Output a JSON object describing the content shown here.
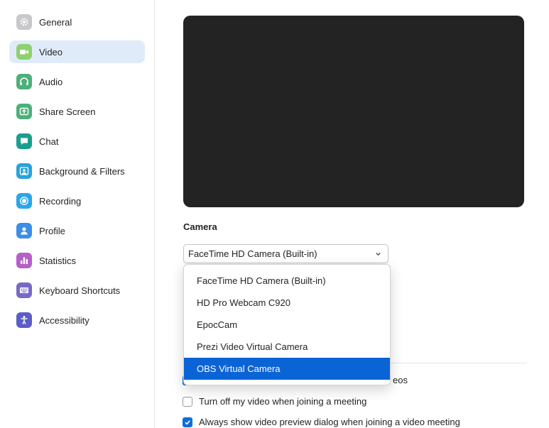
{
  "sidebar": {
    "items": [
      {
        "label": "General",
        "icon": "gear-icon",
        "color": "#c7c7cc"
      },
      {
        "label": "Video",
        "icon": "video-camera-icon",
        "color": "#8ed16e",
        "active": true
      },
      {
        "label": "Audio",
        "icon": "headphones-icon",
        "color": "#4cb07a"
      },
      {
        "label": "Share Screen",
        "icon": "share-screen-icon",
        "color": "#4cb07a"
      },
      {
        "label": "Chat",
        "icon": "chat-bubble-icon",
        "color": "#1a9e8e"
      },
      {
        "label": "Background & Filters",
        "icon": "background-person-icon",
        "color": "#27a3d9"
      },
      {
        "label": "Recording",
        "icon": "record-icon",
        "color": "#2aa6e8"
      },
      {
        "label": "Profile",
        "icon": "profile-person-icon",
        "color": "#3c8ee6"
      },
      {
        "label": "Statistics",
        "icon": "bar-chart-icon",
        "color": "#b65fc7"
      },
      {
        "label": "Keyboard Shortcuts",
        "icon": "keyboard-icon",
        "color": "#7a68c9"
      },
      {
        "label": "Accessibility",
        "icon": "accessibility-icon",
        "color": "#5b5ec4"
      }
    ]
  },
  "camera": {
    "title": "Camera",
    "selected": "FaceTime HD Camera (Built-in)",
    "options": [
      "FaceTime HD Camera (Built-in)",
      "HD Pro Webcam C920",
      "EpocCam",
      "Prezi Video Virtual Camera",
      "OBS Virtual Camera"
    ],
    "highlighted_option": "OBS Virtual Camera"
  },
  "options": {
    "partial_label": "eos",
    "turn_off_video": {
      "label": "Turn off my video when joining a meeting",
      "checked": false
    },
    "show_preview": {
      "label": "Always show video preview dialog when joining a video meeting",
      "checked": true
    }
  },
  "colors": {
    "accent": "#0e6ed9",
    "menu_highlight": "#0b64d6",
    "active_nav_bg": "#e0ebfa",
    "preview_bg": "#232323"
  }
}
